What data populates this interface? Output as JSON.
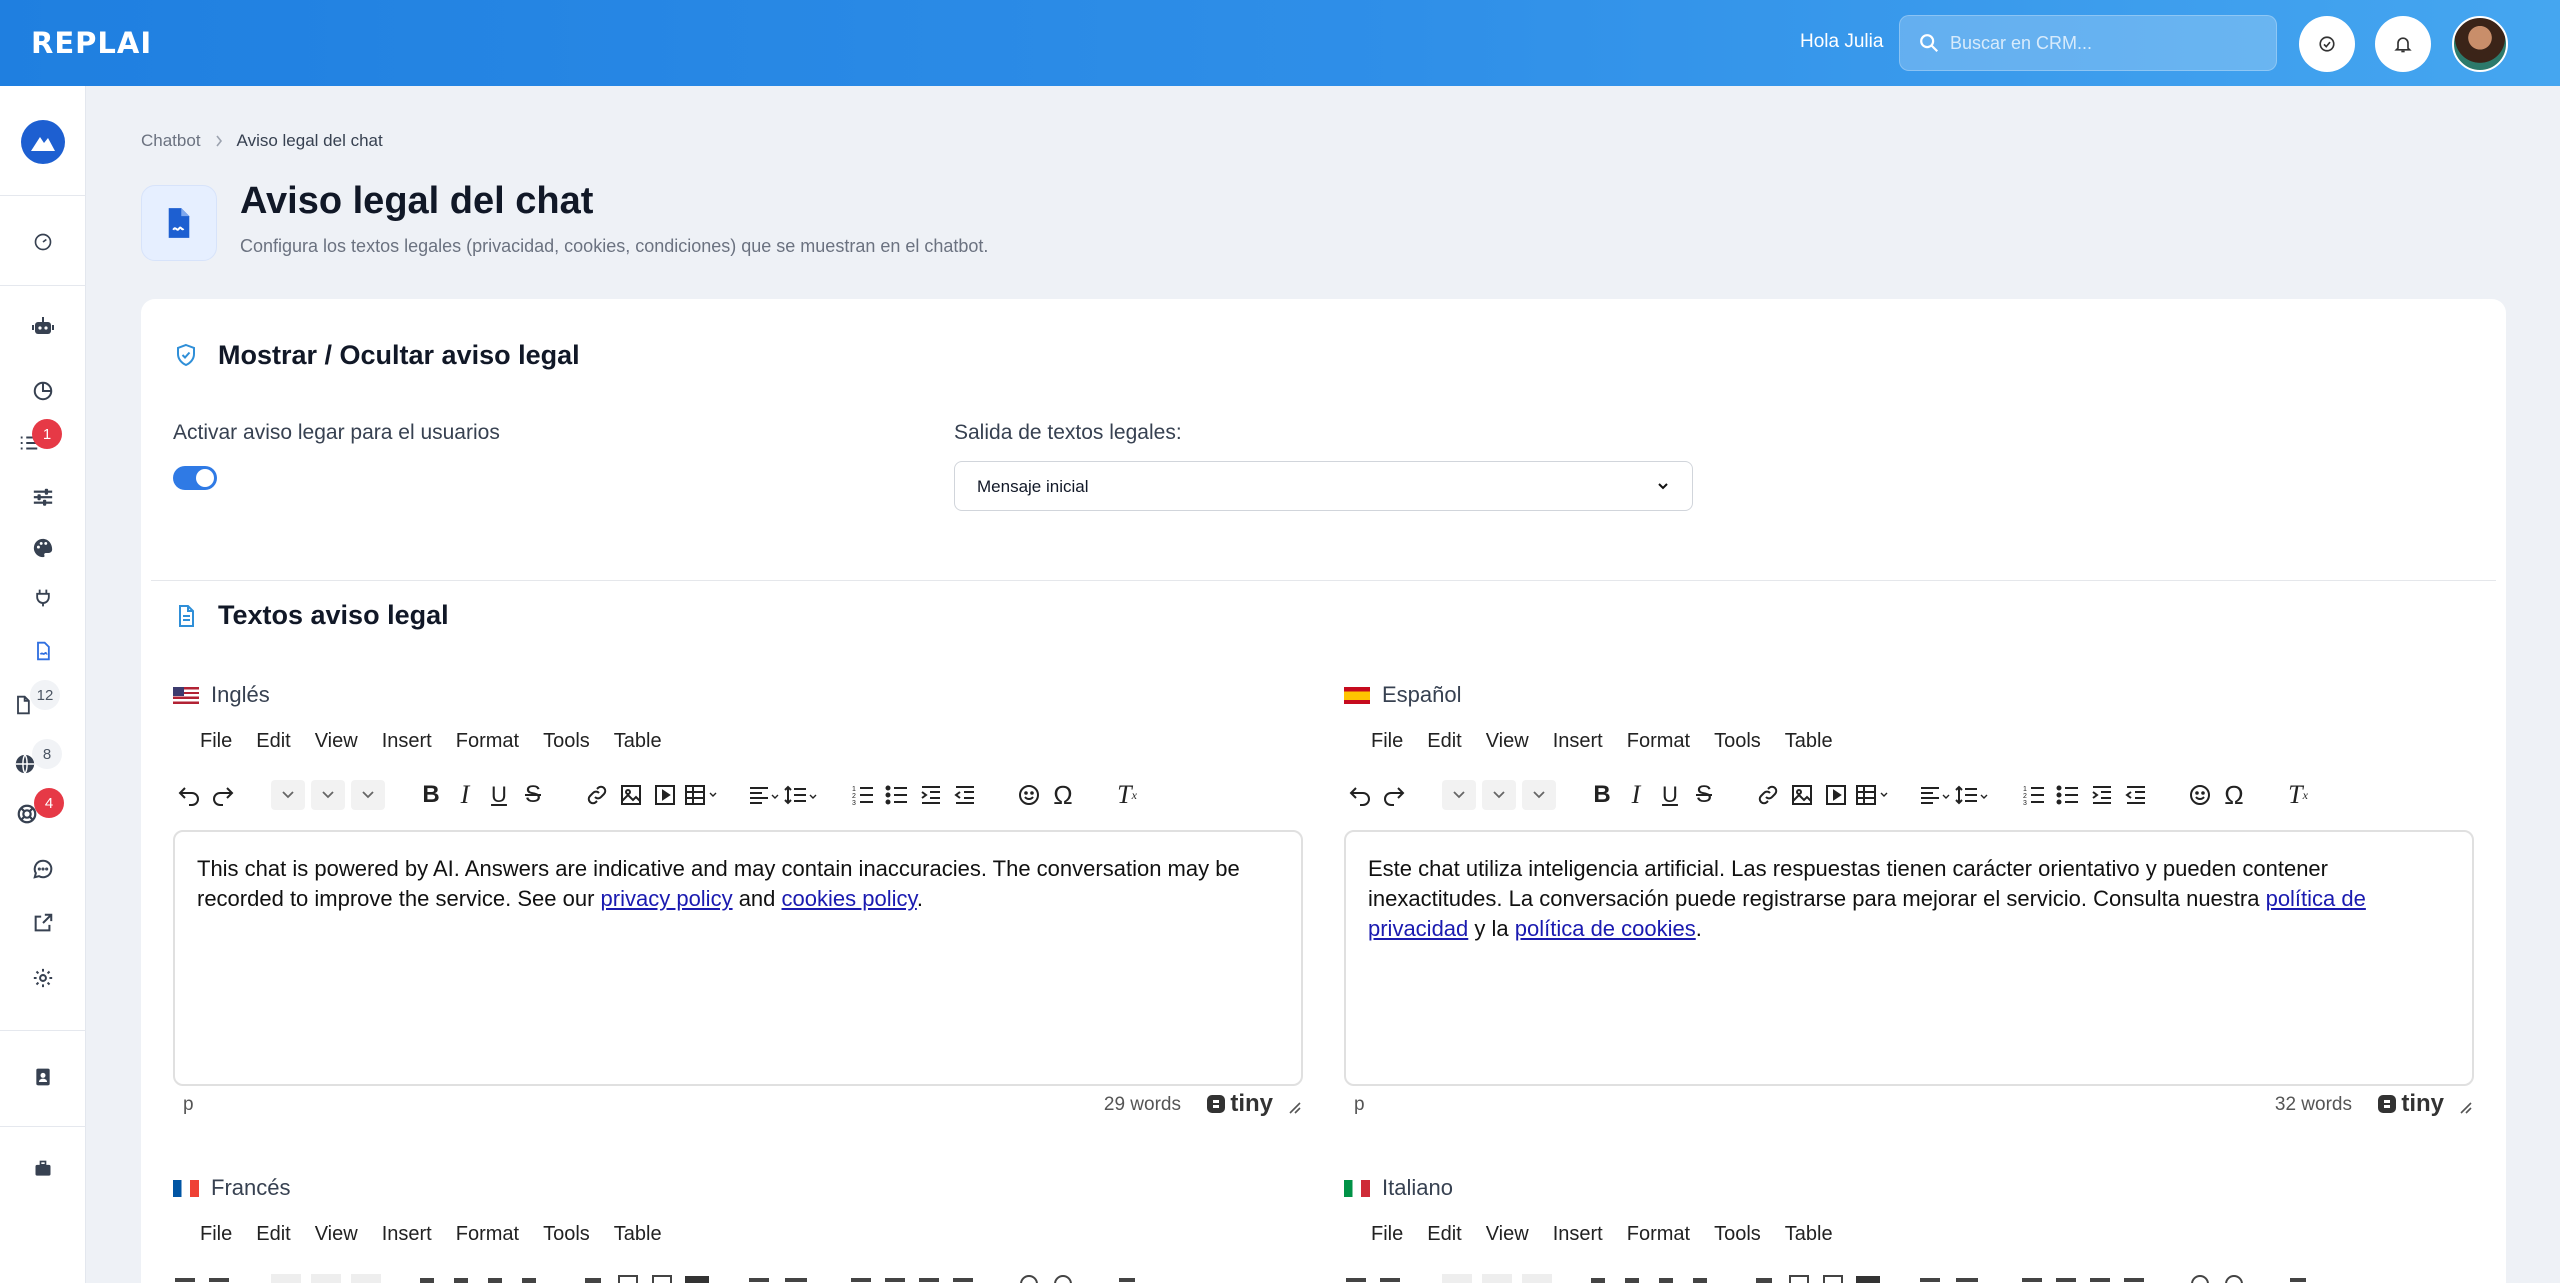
{
  "app": {
    "logo": "REPLAI",
    "greeting": "Hola Julia",
    "search_placeholder": "Buscar en CRM..."
  },
  "sidebar": {
    "badges": {
      "list": "1",
      "documents": "12",
      "web": "8",
      "settings_alerts": "4"
    }
  },
  "breadcrumb": {
    "parent": "Chatbot",
    "current": "Aviso legal del chat"
  },
  "header": {
    "title": "Aviso legal del chat",
    "subtitle": "Configura los textos legales (privacidad, cookies, condiciones) que se muestran en el chatbot."
  },
  "visibility": {
    "title": "Mostrar / Ocultar aviso legal",
    "toggle_label": "Activar aviso legar para el usuarios",
    "toggle_on": true,
    "output_label": "Salida de textos legales:",
    "output_value": "Mensaje inicial"
  },
  "texts": {
    "title": "Textos aviso legal",
    "menu": [
      "File",
      "Edit",
      "View",
      "Insert",
      "Format",
      "Tools",
      "Table"
    ],
    "editors": [
      {
        "lang": "Inglés",
        "p1": "This chat is powered by AI. Answers are indicative and may contain inaccuracies. The conversation may be recorded to improve the service. See our ",
        "link1": "privacy policy",
        "p2": " and ",
        "link2": "cookies policy",
        "p3": ".",
        "words": "29 words",
        "element_path": "p"
      },
      {
        "lang": "Español",
        "p1": "Este chat utiliza inteligencia artificial. Las respuestas tienen carácter orientativo y pueden contener inexactitudes. La conversación puede registrarse para mejorar el servicio. Consulta nuestra ",
        "link1": "política de privacidad",
        "p2": " y la ",
        "link2": "política de cookies",
        "p3": ".",
        "words": "32 words",
        "element_path": "p"
      },
      {
        "lang": "Francés"
      },
      {
        "lang": "Italiano"
      }
    ],
    "brand": "tiny"
  }
}
